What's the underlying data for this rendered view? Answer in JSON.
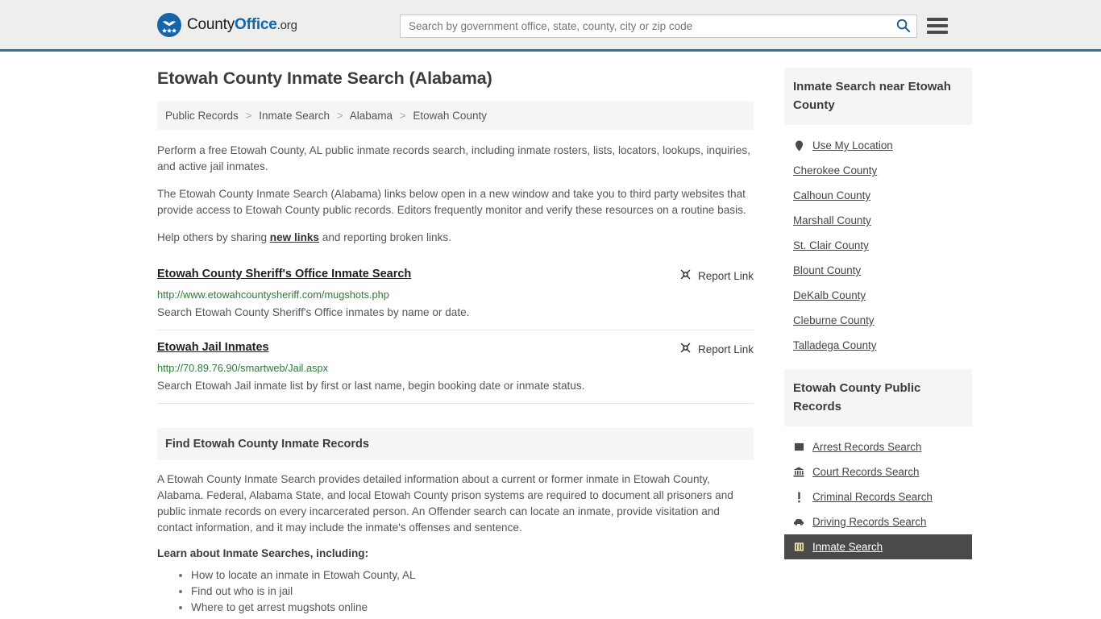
{
  "header": {
    "logo": {
      "text_part1": "County",
      "text_part2": "Office",
      "text_tld": ".org",
      "icon": "eagle-shield-icon"
    },
    "search": {
      "placeholder": "Search by government office, state, county, city or zip code",
      "value": "",
      "button_icon": "search-icon"
    },
    "menu_icon": "hamburger-menu-icon"
  },
  "main": {
    "title": "Etowah County Inmate Search (Alabama)",
    "breadcrumb": [
      "Public Records",
      "Inmate Search",
      "Alabama",
      "Etowah County"
    ],
    "breadcrumb_separator": ">",
    "paragraphs": {
      "intro": "Perform a free Etowah County, AL public inmate records search, including inmate rosters, lists, locators, lookups, inquiries, and active jail inmates.",
      "disclaimer": "The Etowah County Inmate Search (Alabama) links below open in a new window and take you to third party websites that provide access to Etowah County public records. Editors frequently monitor and verify these resources on a routine basis.",
      "share_prefix": "Help others by sharing ",
      "share_link": "new links",
      "share_suffix": " and reporting broken links."
    },
    "results": [
      {
        "title": "Etowah County Sheriff's Office Inmate Search",
        "url": "http://www.etowahcountysheriff.com/mugshots.php",
        "description": "Search Etowah County Sheriff's Office inmates by name or date.",
        "report_label": "Report Link",
        "report_icon": "broken-link-icon"
      },
      {
        "title": "Etowah Jail Inmates",
        "url": "http://70.89.76.90/smartweb/Jail.aspx",
        "description": "Search Etowah Jail inmate list by first or last name, begin booking date or inmate status.",
        "report_label": "Report Link",
        "report_icon": "broken-link-icon"
      }
    ],
    "section": {
      "band_title": "Find Etowah County Inmate Records",
      "body": "A Etowah County Inmate Search provides detailed information about a current or former inmate in Etowah County, Alabama. Federal, Alabama State, and local Etowah County prison systems are required to document all prisoners and public inmate records on every incarcerated person. An Offender search can locate an inmate, provide visitation and contact information, and it may include the inmate's offenses and sentence.",
      "learn_heading": "Learn about Inmate Searches, including:",
      "bullets": [
        "How to locate an inmate in Etowah County, AL",
        "Find out who is in jail",
        "Where to get arrest mugshots online"
      ]
    }
  },
  "sidebar": {
    "nearby": {
      "heading": "Inmate Search near Etowah County",
      "items": [
        {
          "label": "Use My Location",
          "icon": "map-pin-icon",
          "active": false
        },
        {
          "label": "Cherokee County",
          "icon": "",
          "active": false
        },
        {
          "label": "Calhoun County",
          "icon": "",
          "active": false
        },
        {
          "label": "Marshall County",
          "icon": "",
          "active": false
        },
        {
          "label": "St. Clair County",
          "icon": "",
          "active": false
        },
        {
          "label": "Blount County",
          "icon": "",
          "active": false
        },
        {
          "label": "DeKalb County",
          "icon": "",
          "active": false
        },
        {
          "label": "Cleburne County",
          "icon": "",
          "active": false
        },
        {
          "label": "Talladega County",
          "icon": "",
          "active": false
        }
      ]
    },
    "public_records": {
      "heading": "Etowah County Public Records",
      "items": [
        {
          "label": "Arrest Records Search",
          "icon": "fingerprint-card-icon",
          "active": false
        },
        {
          "label": "Court Records Search",
          "icon": "courthouse-icon",
          "active": false
        },
        {
          "label": "Criminal Records Search",
          "icon": "exclamation-icon",
          "active": false
        },
        {
          "label": "Driving Records Search",
          "icon": "car-icon",
          "active": false
        },
        {
          "label": "Inmate Search",
          "icon": "jail-door-icon",
          "active": true
        }
      ]
    }
  },
  "colors": {
    "brand_blue": "#1565a8",
    "header_rule": "#336e9e",
    "header_bg": "#eeeeec",
    "band_bg": "#f5f5f5",
    "url_green": "#2d7a39",
    "active_bg": "#4a4a4a"
  }
}
